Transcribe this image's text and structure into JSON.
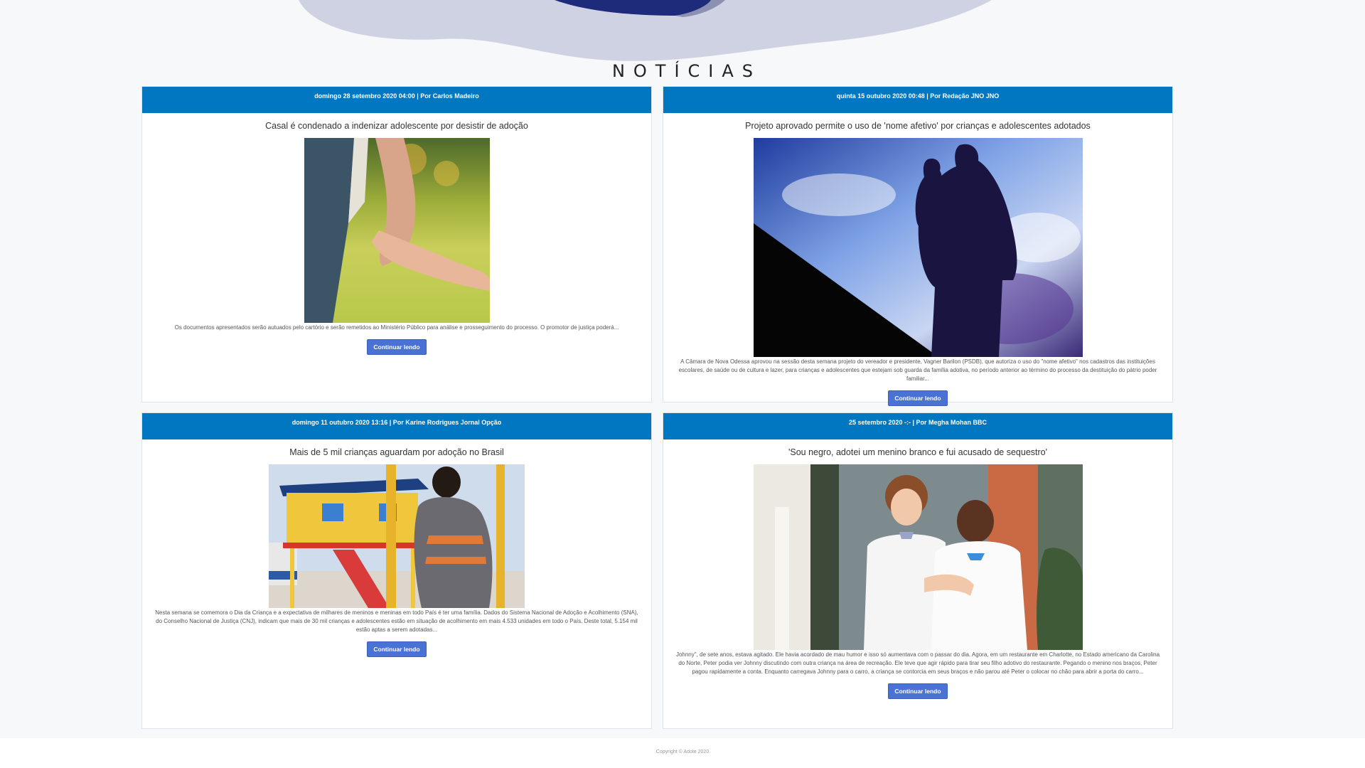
{
  "section_title": "NOTÍCIAS",
  "read_more_label": "Continuar lendo",
  "footer": "Copyright © Adote 2020",
  "colors": {
    "header_bar": "#0077c0",
    "button": "#4a72d4",
    "hero_blob": "#cfd2e3"
  },
  "articles": [
    {
      "meta": "domingo 28 setembro 2020 04:00 | Por Carlos Madeiro",
      "title": "Casal é condenado a indenizar adolescente por desistir de adoção",
      "image": "adult-holding-child-hand-photo",
      "excerpt": "Os documentos apresentados serão autuados pelo cartório e serão remetidos ao Ministério Público para análise e prosseguimento do processo. O promotor de justiça poderá..."
    },
    {
      "meta": "quinta 15 outubro 2020 00:48 | Por Redação JNO JNO",
      "title": "Projeto aprovado permite o uso de 'nome afetivo' por crianças e adolescentes adotados",
      "image": "father-carrying-child-silhouette-photo",
      "excerpt": "A Câmara de Nova Odessa aprovou na sessão desta semana projeto do vereador e presidente, Vagner Barilon (PSDB), que autoriza o uso do \"nome afetivo\" nos cadastros das instituições escolares, de saúde ou de cultura e lazer, para crianças e adolescentes que estejam sob guarda da família adotiva, no período anterior ao término do processo da destituição do pátrio poder familiar..."
    },
    {
      "meta": "domingo 11 outubro 2020 13:16 | Por Karine Rodrigues Jornal Opção",
      "title": "Mais de 5 mil crianças aguardam por adoção no Brasil",
      "image": "child-at-playground-photo",
      "excerpt": "Nesta semana se comemora o Dia da Criança e a expectativa de milhares de meninos e meninas em todo País é ter uma família. Dados do Sistema Nacional de Adoção e Acolhimento (SNA), do Conselho Nacional de Justiça (CNJ), indicam que mais de 30 mil crianças e adolescentes estão em situação de acolhimento em mais 4.533 unidades em todo o País. Deste total, 5.154 mil estão aptas a serem adotadas..."
    },
    {
      "meta": "25 setembro 2020 -:- | Por Megha Mohan BBC",
      "title": "'Sou negro, adotei um menino branco e fui acusado de sequestro'",
      "image": "father-and-son-embrace-photo",
      "excerpt": "Johnny\", de sete anos, estava agitado. Ele havia acordado de mau humor e isso só aumentava com o passar do dia. Agora, em um restaurante em Charlotte, no Estado americano da Carolina do Norte, Peter podia ver Johnny discutindo com outra criança na área de recreação. Ele teve que agir rápido para tirar seu filho adotivo do restaurante. Pegando o menino nos braços, Peter pagou rapidamente a conta. Enquanto carregava Johnny para o carro, a criança se contorcia em seus braços e não parou até Peter o colocar no chão para abrir a porta do carro..."
    }
  ]
}
